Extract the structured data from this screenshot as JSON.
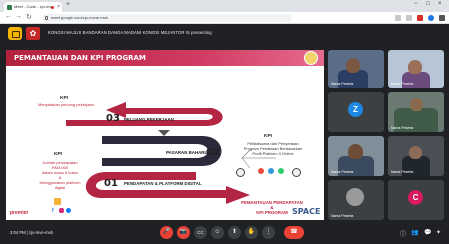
{
  "browser": {
    "tab_title": "Meet - Code - zjo-mve",
    "url": "meet.google.com/zjo-mvne-mvb",
    "window_controls": [
      "−",
      "□",
      "×"
    ]
  },
  "meet": {
    "presenting_text": "KONGSI MAJLIS BANDARAN DANGA MADANI KONGSI MEJANTOR IS presenting",
    "meeting_time": "3:04 PM",
    "meeting_code": "zjo-mve-mvb",
    "separator": "|"
  },
  "slide": {
    "title": "PEMANTAUAN DAN KPI PROGRAM",
    "kpi_top_label": "KPI",
    "kpi_top_text": "Menyatakan peluang pekerjaan",
    "kpi_left_label": "KPI",
    "kpi_left_text": [
      "Jumlah pendapatan RM2,000",
      "dalam masa 6 bulan",
      "&",
      "Menggunakan platform",
      "digital"
    ],
    "kpi_right_label": "KPI",
    "kpi_right_text": [
      "Pelibatsama dan Penyertaan",
      "Program Penataran Berdasarkan",
      "Profil Platform 3 Online"
    ],
    "stage3_num": "03",
    "stage3_label": "PELUANG PEKERJAAN",
    "stage2_num": "02",
    "stage2_label": "PASARAN BAHARU",
    "stage1_num": "01",
    "stage1_label": "PENDAPATAN & PLATFORM DIGITAL",
    "center_title": [
      "PEMANTAUAN PENDAPATAN",
      "&",
      "KPI PROGRAM"
    ],
    "logo_left": "premier",
    "logo_right": "SPACE",
    "colors": {
      "accent": "#c0283c",
      "dark": "#2a2a3a"
    }
  },
  "participants": [
    {
      "label": "Nama Peserta"
    },
    {
      "label": "Nama Peserta"
    },
    {
      "label": "Z",
      "initial": "Z",
      "color": "#1e88e5"
    },
    {
      "label": "Nama Peserta"
    },
    {
      "label": "Nama Peserta"
    },
    {
      "label": "Nama Peserta"
    },
    {
      "label": "Nama Peserta"
    },
    {
      "label": "C",
      "initial": "C",
      "color": "#d81b60"
    }
  ],
  "controls": {
    "mic": "🎤",
    "cam": "📷",
    "cc": "CC",
    "emoji": "☺",
    "present": "⬆",
    "raise": "✋",
    "more": "⋮",
    "hangup": "☎",
    "info": "ⓘ",
    "people": "👥",
    "chat": "💬",
    "activities": "✦"
  }
}
